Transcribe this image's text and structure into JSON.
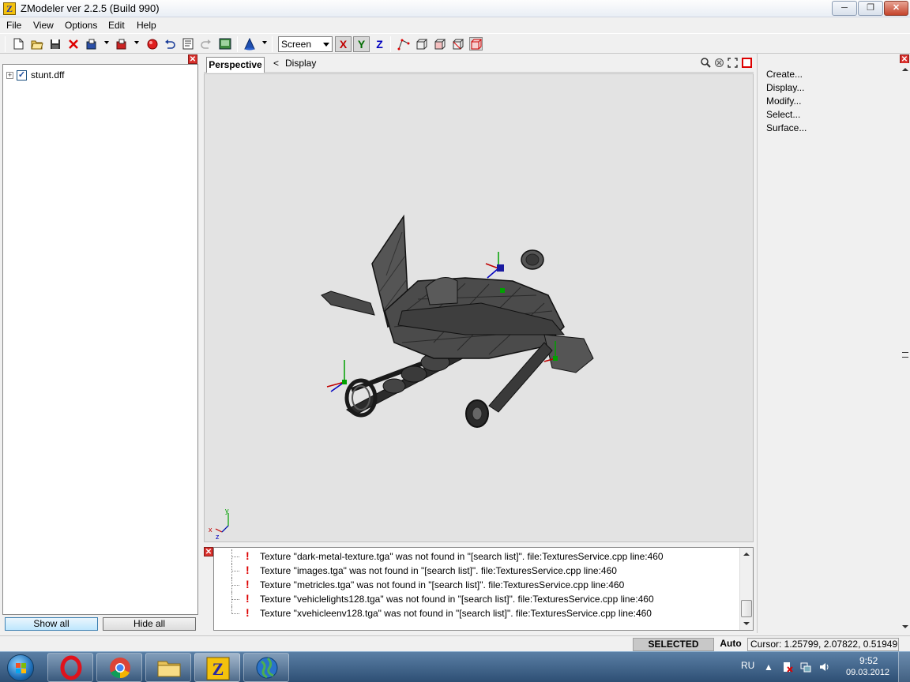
{
  "window": {
    "title": "ZModeler ver 2.2.5 (Build 990)",
    "app_icon_letter": "Z",
    "minimize_glyph": "─",
    "maximize_glyph": "❐",
    "close_glyph": "✕"
  },
  "menu": {
    "items": [
      "File",
      "View",
      "Options",
      "Edit",
      "Help"
    ]
  },
  "toolbar": {
    "icons": [
      "new-file-icon",
      "open-folder-icon",
      "save-icon",
      "delete-icon",
      "import-icon",
      "export-icon",
      "record-icon",
      "undo-icon",
      "properties-icon",
      "redo-icon",
      "render-icon",
      "cone-icon"
    ],
    "space_select": "Screen",
    "axis_x": "X",
    "axis_y": "Y",
    "axis_z": "Z",
    "view_icons": [
      "vertex-mode-icon",
      "box-mode-icon",
      "face-mode-icon",
      "object-mode-icon",
      "selection-mode-icon"
    ]
  },
  "scene_tree": {
    "expand_glyph": "+",
    "check_glyph": "✓",
    "root_label": "stunt.dff",
    "root_checked": true,
    "show_all_label": "Show all",
    "hide_all_label": "Hide all"
  },
  "viewport": {
    "tab_label": "Perspective",
    "back_glyph": "<",
    "breadcrumb": "Display",
    "axis_gizmo_x": "x",
    "axis_gizmo_y": "y",
    "axis_gizmo_z": "z",
    "background_color": "#e3e3e3",
    "model_color": "#3a3a3a"
  },
  "log": {
    "bang_glyph": "!",
    "messages": [
      "Texture \"dark-metal-texture.tga\" was not found in \"[search list]\". file:TexturesService.cpp line:460",
      "Texture \"images.tga\" was not found in \"[search list]\". file:TexturesService.cpp line:460",
      "Texture \"metricles.tga\" was not found in \"[search list]\". file:TexturesService.cpp line:460",
      "Texture \"vehiclelights128.tga\" was not found in \"[search list]\". file:TexturesService.cpp line:460",
      "Texture \"xvehicleenv128.tga\" was not found in \"[search list]\". file:TexturesService.cpp line:460"
    ]
  },
  "commands": {
    "items": [
      "Create...",
      "Display...",
      "Modify...",
      "Select...",
      "Surface..."
    ]
  },
  "status": {
    "mode": "SELECTED MODE",
    "auto": "Auto",
    "cursor": "Cursor: 1.25799, 2.07822, 0.51949"
  },
  "taskbar": {
    "apps": [
      "opera-icon",
      "chrome-icon",
      "explorer-folder-icon",
      "zmodeler-icon",
      "globe-icon"
    ],
    "zmodeler_letter": "Z",
    "language": "RU",
    "time": "9:52",
    "date": "09.03.2012"
  }
}
